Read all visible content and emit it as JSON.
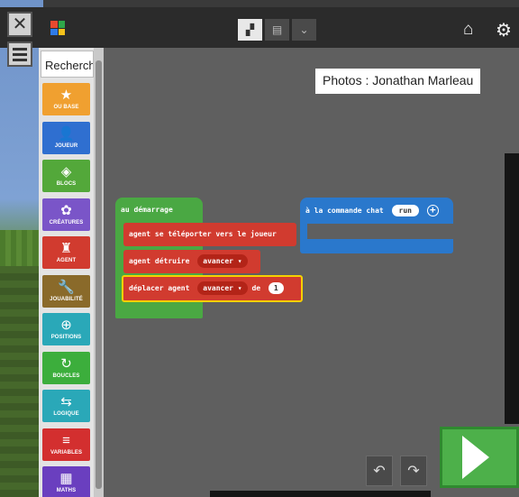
{
  "topbar": {
    "close_icon": "close-x-icon",
    "menu_icon": "hamburger-menu-icon",
    "logo_colors": [
      "#e84a2f",
      "#2fa84a",
      "#2f7be8",
      "#f5c21b"
    ],
    "view_toggle_dropdown": "⌄"
  },
  "toolbox": {
    "search_placeholder": "Recherch",
    "categories": [
      {
        "label": "OU BASE",
        "icon": "star-icon",
        "glyph": "★",
        "color": "#f0a030"
      },
      {
        "label": "JOUEUR",
        "icon": "player-icon",
        "glyph": "👤",
        "color": "#2f6fd0"
      },
      {
        "label": "BLOCS",
        "icon": "cube-icon",
        "glyph": "◈",
        "color": "#53a83a"
      },
      {
        "label": "CRÉATURES",
        "icon": "paw-icon",
        "glyph": "✿",
        "color": "#7a55c8"
      },
      {
        "label": "AGENT",
        "icon": "robot-icon",
        "glyph": "♜",
        "color": "#d13b2f"
      },
      {
        "label": "JOUABILITÉ",
        "icon": "wrench-icon",
        "glyph": "🔧",
        "color": "#8a6a2a"
      },
      {
        "label": "POSITIONS",
        "icon": "crosshair-icon",
        "glyph": "⊕",
        "color": "#2aa8b8"
      },
      {
        "label": "BOUCLES",
        "icon": "loop-icon",
        "glyph": "↻",
        "color": "#3cae3c"
      },
      {
        "label": "LOGIQUE",
        "icon": "shuffle-icon",
        "glyph": "⇆",
        "color": "#2aa8b8"
      },
      {
        "label": "VARIABLES",
        "icon": "list-icon",
        "glyph": "≡",
        "color": "#d32f2f"
      },
      {
        "label": "MATHS",
        "icon": "calculator-icon",
        "glyph": "▦",
        "color": "#6a3fbf"
      }
    ]
  },
  "workspace": {
    "photo_credit": "Photos : Jonathan Marleau",
    "on_start": {
      "label": "au démarrage"
    },
    "blocks": {
      "teleport": "agent se téléporter vers le joueur",
      "destroy_label": "agent détruire",
      "destroy_direction": "avancer ▾",
      "move_label": "déplacer agent",
      "move_direction": "avancer ▾",
      "move_de": "de",
      "move_count": "1"
    },
    "chat_command": {
      "label": "à la commande chat",
      "value": "run",
      "plus": "+"
    }
  },
  "controls": {
    "undo_glyph": "↶",
    "redo_glyph": "↷"
  }
}
